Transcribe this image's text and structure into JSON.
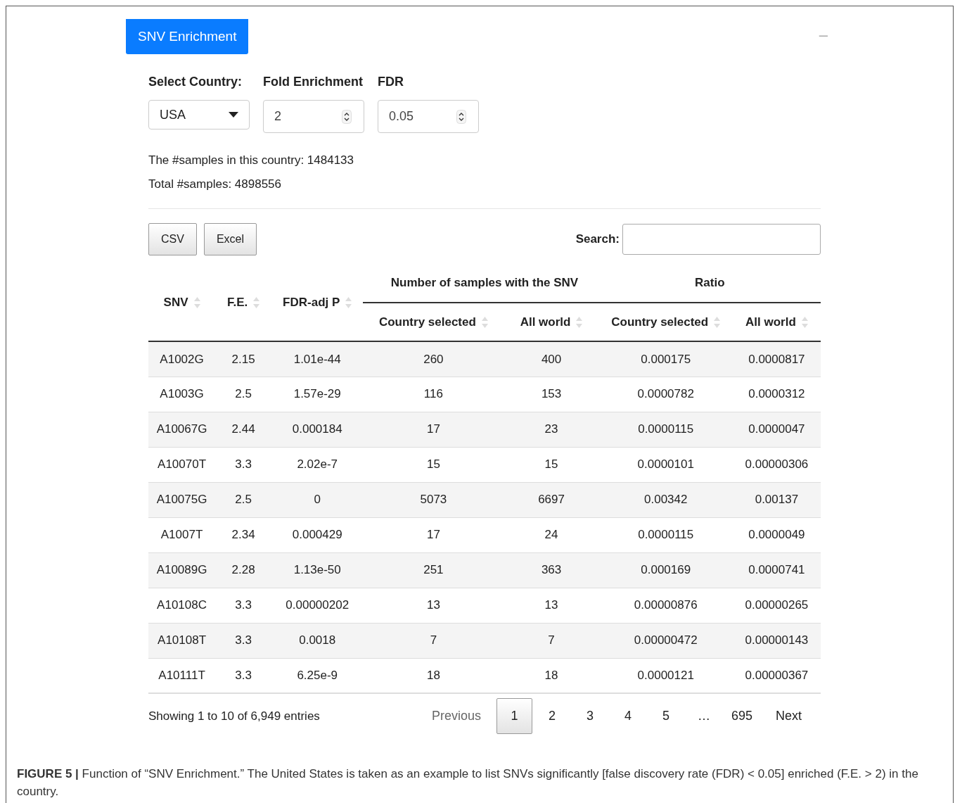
{
  "panel": {
    "title": "SNV Enrichment",
    "collapse_icon": "–"
  },
  "filters": [
    {
      "kind": "select",
      "label": "Select Country:",
      "value": "USA"
    },
    {
      "kind": "number",
      "label": "Fold Enrichment",
      "value": "2"
    },
    {
      "kind": "number",
      "label": "FDR",
      "value": "0.05"
    }
  ],
  "summary": [
    "The #samples in this country: 1484133",
    "Total #samples: 4898556"
  ],
  "export_buttons": [
    "CSV",
    "Excel"
  ],
  "search": {
    "label": "Search:"
  },
  "table": {
    "groups": [
      {
        "label": "Number of samples with the SNV"
      },
      {
        "label": "Ratio"
      }
    ],
    "columns": [
      "SNV",
      "F.E.",
      "FDR-adj P",
      "Country selected",
      "All world",
      "Country selected",
      "All world"
    ],
    "rows": [
      [
        "A1002G",
        "2.15",
        "1.01e-44",
        "260",
        "400",
        "0.000175",
        "0.0000817"
      ],
      [
        "A1003G",
        "2.5",
        "1.57e-29",
        "116",
        "153",
        "0.0000782",
        "0.0000312"
      ],
      [
        "A10067G",
        "2.44",
        "0.000184",
        "17",
        "23",
        "0.0000115",
        "0.0000047"
      ],
      [
        "A10070T",
        "3.3",
        "2.02e-7",
        "15",
        "15",
        "0.0000101",
        "0.00000306"
      ],
      [
        "A10075G",
        "2.5",
        "0",
        "5073",
        "6697",
        "0.00342",
        "0.00137"
      ],
      [
        "A1007T",
        "2.34",
        "0.000429",
        "17",
        "24",
        "0.0000115",
        "0.0000049"
      ],
      [
        "A10089G",
        "2.28",
        "1.13e-50",
        "251",
        "363",
        "0.000169",
        "0.0000741"
      ],
      [
        "A10108C",
        "3.3",
        "0.00000202",
        "13",
        "13",
        "0.00000876",
        "0.00000265"
      ],
      [
        "A10108T",
        "3.3",
        "0.0018",
        "7",
        "7",
        "0.00000472",
        "0.00000143"
      ],
      [
        "A10111T",
        "3.3",
        "6.25e-9",
        "18",
        "18",
        "0.0000121",
        "0.00000367"
      ]
    ]
  },
  "info": "Showing 1 to 10 of 6,949 entries",
  "pagination": [
    {
      "label": "Previous",
      "kind": "nav",
      "disabled": true,
      "selected": false
    },
    {
      "label": "1",
      "kind": "page",
      "selected": true
    },
    {
      "label": "2",
      "kind": "page",
      "selected": false
    },
    {
      "label": "3",
      "kind": "page",
      "selected": false
    },
    {
      "label": "4",
      "kind": "page",
      "selected": false
    },
    {
      "label": "5",
      "kind": "page",
      "selected": false
    },
    {
      "label": "…",
      "kind": "ellipsis"
    },
    {
      "label": "695",
      "kind": "page",
      "selected": false
    },
    {
      "label": "Next",
      "kind": "nav",
      "disabled": false,
      "selected": false
    }
  ],
  "caption": "**FIGURE 5 |** Function of “SNV Enrichment.” The United States is taken as an example to list SNVs significantly [false discovery rate (FDR) < 0.05] enriched (F.E. > 2) in the country."
}
